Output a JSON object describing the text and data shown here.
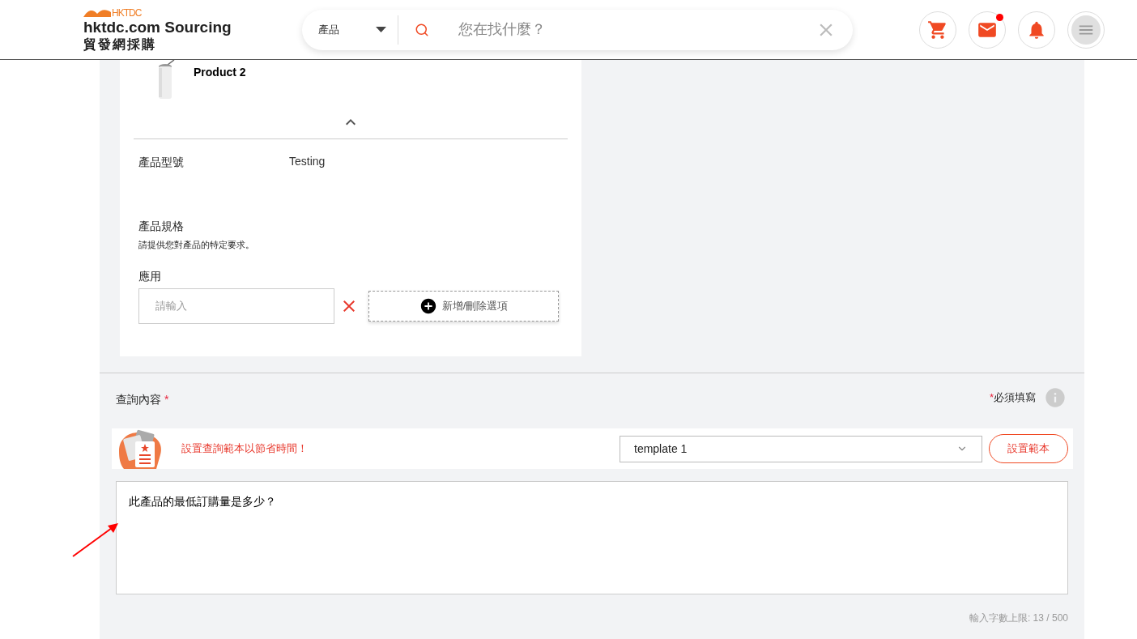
{
  "header": {
    "logo": {
      "brand": "HKTDC",
      "title": "hktdc.com Sourcing",
      "subtitle": "貿發網採購"
    },
    "search": {
      "category": "產品",
      "placeholder": "您在找什麼？"
    },
    "actions": [
      {
        "kind": "cart",
        "badge": false
      },
      {
        "kind": "mail",
        "badge": true
      },
      {
        "kind": "bell",
        "badge": false
      },
      {
        "kind": "menu",
        "badge": false
      }
    ]
  },
  "product": {
    "name": "Product 2",
    "expanded": true
  },
  "fields": [
    {
      "label": "產品型號",
      "value": "Testing"
    }
  ],
  "spec": {
    "title": "產品規格",
    "hint": "請提供您對產品的特定要求。",
    "option_label": "應用",
    "input_placeholder": "請輸入",
    "add_button": "新增/刪除選項"
  },
  "enquiry": {
    "label": "查詢內容",
    "required_mark": "*",
    "required_note_mark": "*",
    "required_note": "必須填寫",
    "template_prompt": "設置查詢範本以節省時間！",
    "template_value": "template 1",
    "template_button": "設置範本",
    "message": "此產品的最低訂購量是多少？",
    "counter": "輸入字數上限: 13 / 500"
  }
}
